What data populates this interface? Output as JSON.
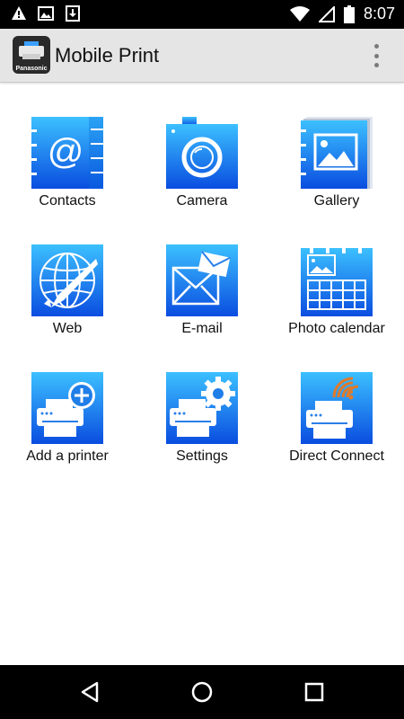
{
  "status_bar": {
    "time": "8:07",
    "left_icons": [
      "warning-icon",
      "image-icon",
      "download-icon"
    ],
    "right_icons": [
      "wifi-icon",
      "signal-icon",
      "battery-icon"
    ]
  },
  "app_bar": {
    "logo_text": "Panasonic",
    "title": "Mobile Print",
    "menu_icon": "overflow-menu-icon"
  },
  "tiles": [
    {
      "label": "Contacts",
      "icon": "contacts-icon"
    },
    {
      "label": "Camera",
      "icon": "camera-icon"
    },
    {
      "label": "Gallery",
      "icon": "gallery-icon"
    },
    {
      "label": "Web",
      "icon": "web-icon"
    },
    {
      "label": "E-mail",
      "icon": "email-icon"
    },
    {
      "label": "Photo calendar",
      "icon": "photo-calendar-icon"
    },
    {
      "label": "Add a printer",
      "icon": "add-printer-icon"
    },
    {
      "label": "Settings",
      "icon": "settings-icon"
    },
    {
      "label": "Direct Connect",
      "icon": "direct-connect-icon"
    }
  ],
  "nav_bar": {
    "buttons": [
      "back-icon",
      "home-icon",
      "recents-icon"
    ]
  },
  "colors": {
    "tile_gradient_top": "#35b8ff",
    "tile_gradient_bottom": "#0a4fe0",
    "app_bar": "#e5e5e5",
    "status_bar": "#000000",
    "wifi_signal": "#e07a2a"
  }
}
